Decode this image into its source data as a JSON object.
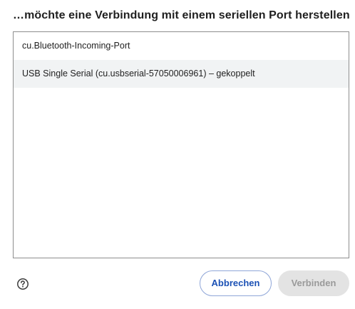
{
  "dialog": {
    "title": "…möchte eine Verbindung mit einem seriellen Port herstellen"
  },
  "ports": [
    {
      "label": "cu.Bluetooth-Incoming-Port",
      "selected": false
    },
    {
      "label": "USB Single Serial (cu.usbserial-57050006961) – gekoppelt",
      "selected": true
    }
  ],
  "footer": {
    "help_icon": "help-circle-icon",
    "cancel_label": "Abbrechen",
    "connect_label": "Verbinden",
    "connect_enabled": false
  },
  "colors": {
    "accent": "#1b51b5",
    "selected_row": "#f1f3f4",
    "disabled_button": "#e3e3e3"
  }
}
